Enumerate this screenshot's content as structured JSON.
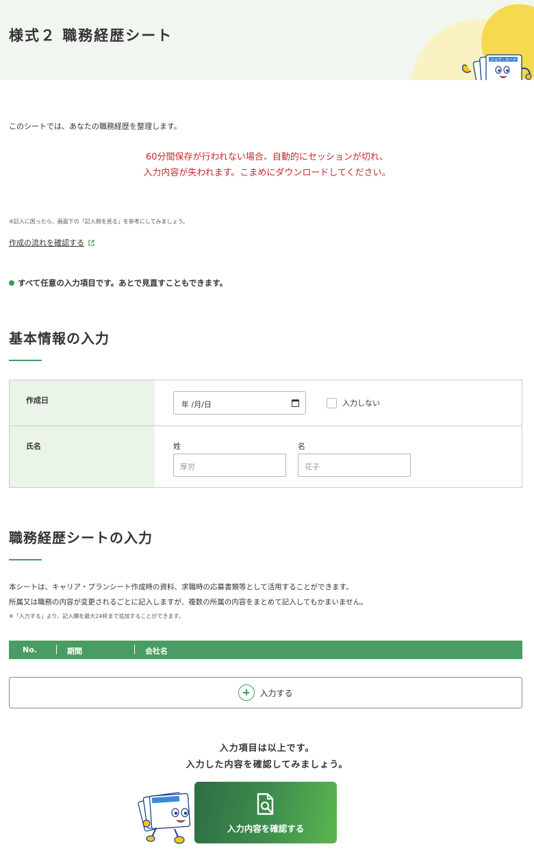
{
  "header": {
    "title": "様式２ 職務経歴シート"
  },
  "intro": "このシートでは、あなたの職務経歴を整理します。",
  "warning": {
    "line1": "60分間保存が行われない場合、自動的にセッションが切れ、",
    "line2": "入力内容が失われます。こまめにダウンロードしてください。"
  },
  "hint": "※記入に困ったら、画面下の「記入例を見る」を参考にしてみましょう。",
  "flow_link": "作成の流れを確認する",
  "optional_note": "すべて任意の入力項目です。あとで見直すこともできます。",
  "basic_section": {
    "title": "基本情報の入力",
    "date_label": "作成日",
    "date_value": "年 /月/日",
    "no_input_label": "入力しない",
    "name_label": "氏名",
    "last_name_label": "姓",
    "last_name_placeholder": "厚労",
    "first_name_label": "名",
    "first_name_placeholder": "花子"
  },
  "career_section": {
    "title": "職務経歴シートの入力",
    "desc1": "本シートは、キャリア・プランシート作成時の資料、求職時の応募書類等として活用することができます。",
    "desc2": "所属又は職務の内容が変更されるごとに記入しますが、複数の所属の内容をまとめて記入してもかまいません。",
    "desc_small": "※「入力する」より、記入欄を最大24枠まで追加することができます。",
    "columns": [
      "No.",
      "期間",
      "会社名"
    ],
    "add_button": "入力する"
  },
  "end_message": {
    "line1": "入力項目は以上です。",
    "line2": "入力した内容を確認してみましょう。"
  },
  "confirm_button": "入力内容を確認する",
  "mascot_label": "ジョブ・カード",
  "colors": {
    "accent_green": "#3d9a5d",
    "warning_red": "#c8262e",
    "header_bg": "#f1f6f0",
    "label_bg": "#ebf4e9"
  },
  "icons": [
    "external-link-icon",
    "calendar-icon",
    "plus-circle-icon",
    "document-search-icon"
  ]
}
